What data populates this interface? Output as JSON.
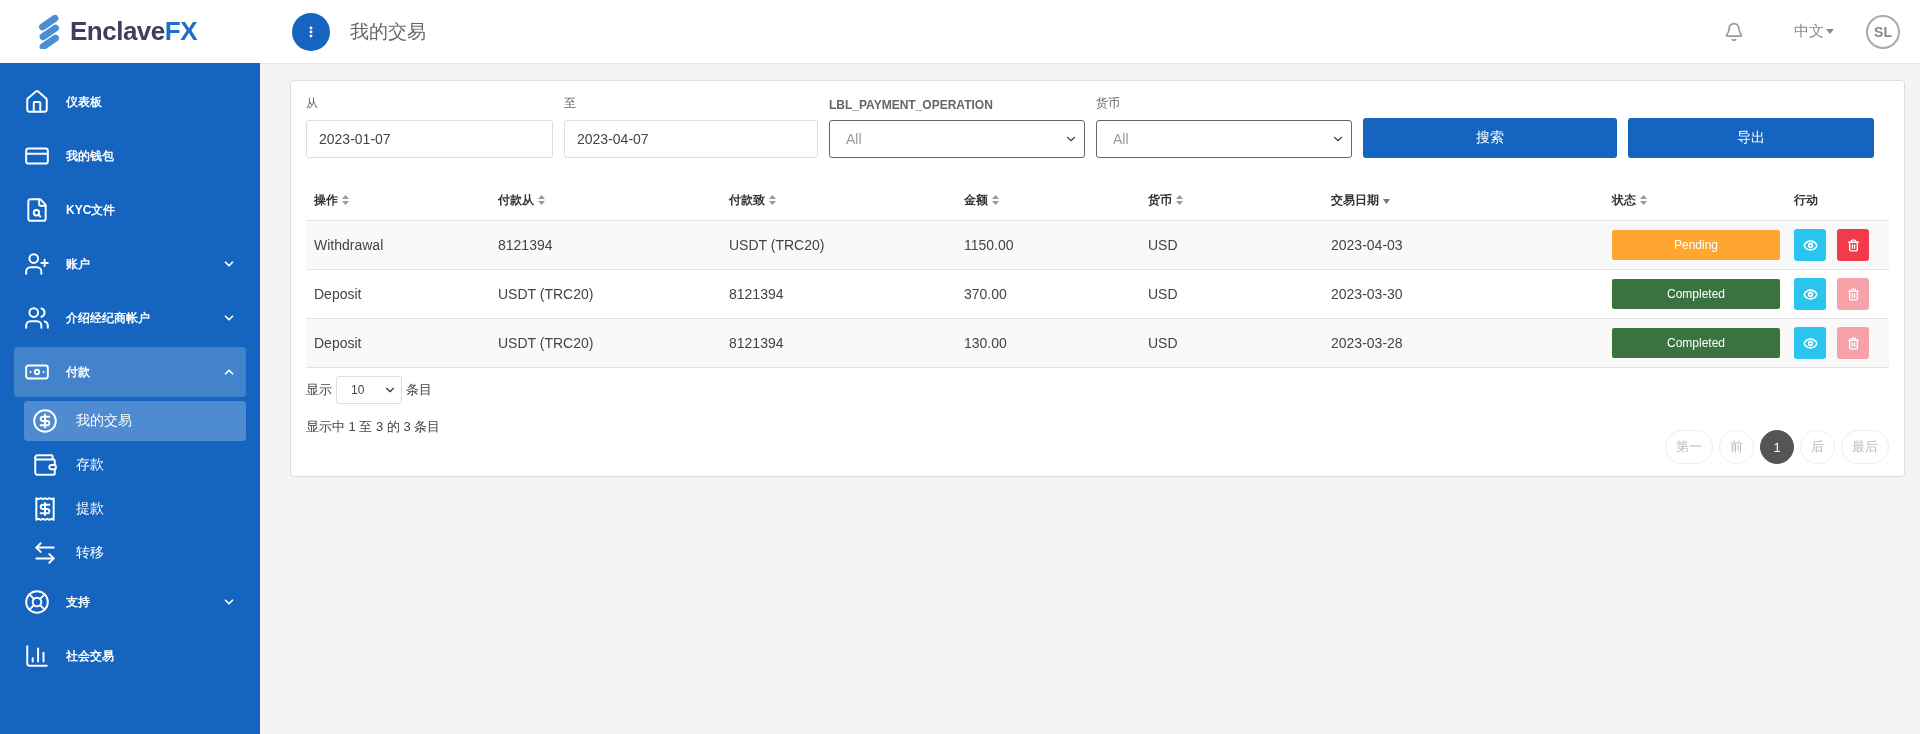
{
  "logo": {
    "text": "Enclave",
    "accent": "FX"
  },
  "sidebar": {
    "items": [
      {
        "label": "仪表板",
        "expandable": false,
        "selected": false
      },
      {
        "label": "我的钱包",
        "expandable": false,
        "selected": false
      },
      {
        "label": "KYC文件",
        "expandable": false,
        "selected": false
      },
      {
        "label": "账户",
        "expandable": true,
        "expanded": false,
        "selected": false
      },
      {
        "label": "介绍经纪商帐户",
        "expandable": true,
        "expanded": false,
        "selected": false
      },
      {
        "label": "付款",
        "expandable": true,
        "expanded": true,
        "selected": true,
        "children": [
          {
            "label": "我的交易",
            "selected": true
          },
          {
            "label": "存款",
            "selected": false
          },
          {
            "label": "提款",
            "selected": false
          },
          {
            "label": "转移",
            "selected": false
          }
        ]
      },
      {
        "label": "支持",
        "expandable": true,
        "expanded": false,
        "selected": false
      },
      {
        "label": "社会交易",
        "expandable": false,
        "selected": false
      }
    ]
  },
  "header": {
    "title": "我的交易",
    "language": "中文",
    "avatar": "SL"
  },
  "filters": {
    "from": {
      "label": "从",
      "value": "2023-01-07"
    },
    "to": {
      "label": "至",
      "value": "2023-04-07"
    },
    "operation": {
      "label": "LBL_PAYMENT_OPERATION",
      "value": "All"
    },
    "currency": {
      "label": "货币",
      "value": "All"
    },
    "buttons": [
      "搜索",
      "导出"
    ]
  },
  "table": {
    "columns": [
      {
        "label": "操作",
        "sortable": true,
        "sorted": false
      },
      {
        "label": "付款从",
        "sortable": true,
        "sorted": false
      },
      {
        "label": "付款致",
        "sortable": true,
        "sorted": false
      },
      {
        "label": "金额",
        "sortable": true,
        "sorted": false
      },
      {
        "label": "货币",
        "sortable": true,
        "sorted": false
      },
      {
        "label": "交易日期",
        "sortable": true,
        "sorted": true
      },
      {
        "label": "状态",
        "sortable": true,
        "sorted": false
      },
      {
        "label": "行动",
        "sortable": false
      }
    ],
    "rows": [
      {
        "operation": "Withdrawal",
        "from": "8121394",
        "to": "USDT (TRC20)",
        "amount": "1150.00",
        "currency": "USD",
        "date": "2023-04-03",
        "status": "Pending",
        "completed": false,
        "delete_disabled": false
      },
      {
        "operation": "Deposit",
        "from": "USDT (TRC20)",
        "to": "8121394",
        "amount": "370.00",
        "currency": "USD",
        "date": "2023-03-30",
        "status": "Completed",
        "completed": true,
        "delete_disabled": true
      },
      {
        "operation": "Deposit",
        "from": "USDT (TRC20)",
        "to": "8121394",
        "amount": "130.00",
        "currency": "USD",
        "date": "2023-03-28",
        "status": "Completed",
        "completed": true,
        "delete_disabled": true
      }
    ]
  },
  "page_size": {
    "before": "显示",
    "value": "10",
    "after": "条目"
  },
  "info": "显示中 1 至 3 的 3 条目",
  "pagination": [
    {
      "label": "第一",
      "selected": false,
      "disabled": true
    },
    {
      "label": "前",
      "selected": false,
      "disabled": true
    },
    {
      "label": "1",
      "selected": true,
      "disabled": false
    },
    {
      "label": "后",
      "selected": false,
      "disabled": true
    },
    {
      "label": "最后",
      "selected": false,
      "disabled": true
    }
  ]
}
